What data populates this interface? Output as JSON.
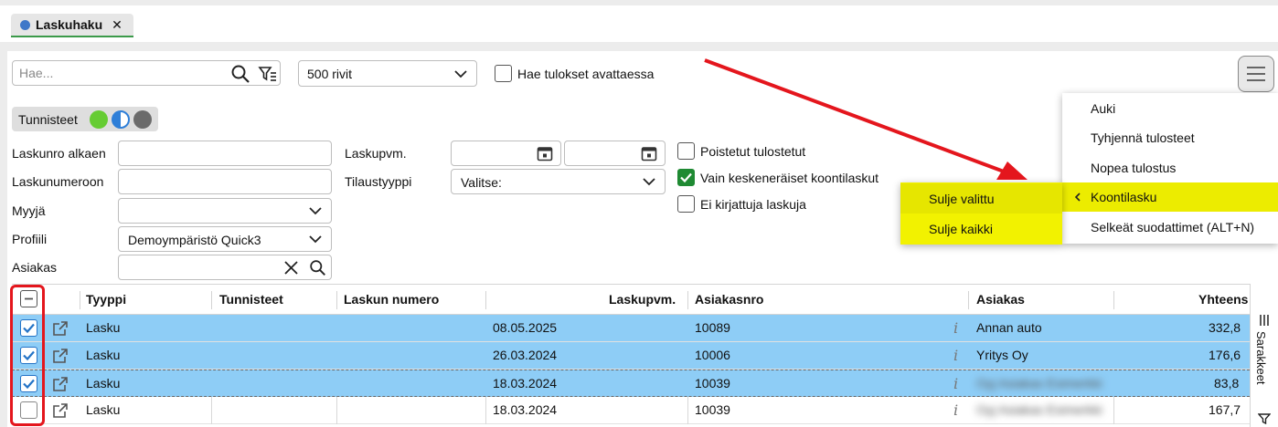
{
  "tab": {
    "label": "Laskuhaku",
    "close": "✕"
  },
  "toolbar": {
    "search_placeholder": "Hae...",
    "rows_select": "500 rivit",
    "open_results_label": "Hae tulokset avattaessa"
  },
  "tags": {
    "label": "Tunnisteet",
    "colors": [
      "#66cc33",
      "#2f7fd8",
      "#6b6b6b"
    ]
  },
  "filters": {
    "invoice_from_label": "Laskunro alkaen",
    "invoice_to_label": "Laskunumeroon",
    "seller_label": "Myyjä",
    "profile_label": "Profiili",
    "profile_value": "Demoympäristö Quick3",
    "customer_label": "Asiakas",
    "invoice_date_label": "Laskupvm.",
    "order_type_label": "Tilaustyyppi",
    "order_type_value": "Valitse:",
    "deleted_printed_label": "Poistetut tulostetut",
    "unfinished_label": "Vain keskeneräiset koontilaskut",
    "unposted_label": "Ei kirjattuja laskuja"
  },
  "dropdown": {
    "items": [
      "Auki",
      "Tyhjennä tulosteet",
      "Nopea tulostus",
      "Koontilasku",
      "Selkeät suodattimet (ALT+N)"
    ],
    "submenu": [
      "Sulje valittu",
      "Sulje kaikki"
    ]
  },
  "grid": {
    "columns": [
      "Tyyppi",
      "Tunnisteet",
      "Laskun numero",
      "Laskupvm.",
      "Asiakasnro",
      "Asiakas",
      "Yhteens"
    ],
    "rows": [
      {
        "type": "Lasku",
        "date": "08.05.2025",
        "customer_no": "10089",
        "customer": "Annan auto",
        "total": "332,8",
        "checked": true
      },
      {
        "type": "Lasku",
        "date": "26.03.2024",
        "customer_no": "10006",
        "customer": "Yritys Oy",
        "total": "176,6",
        "checked": true
      },
      {
        "type": "Lasku",
        "date": "18.03.2024",
        "customer_no": "10039",
        "customer": "Oyj Asiakas Esimerkki",
        "total": "83,8",
        "checked": true
      },
      {
        "type": "Lasku",
        "date": "18.03.2024",
        "customer_no": "10039",
        "customer": "Oyj Asiakas Esimerkki",
        "total": "167,7",
        "checked": false
      }
    ],
    "side_label": "Sarakkeet"
  }
}
